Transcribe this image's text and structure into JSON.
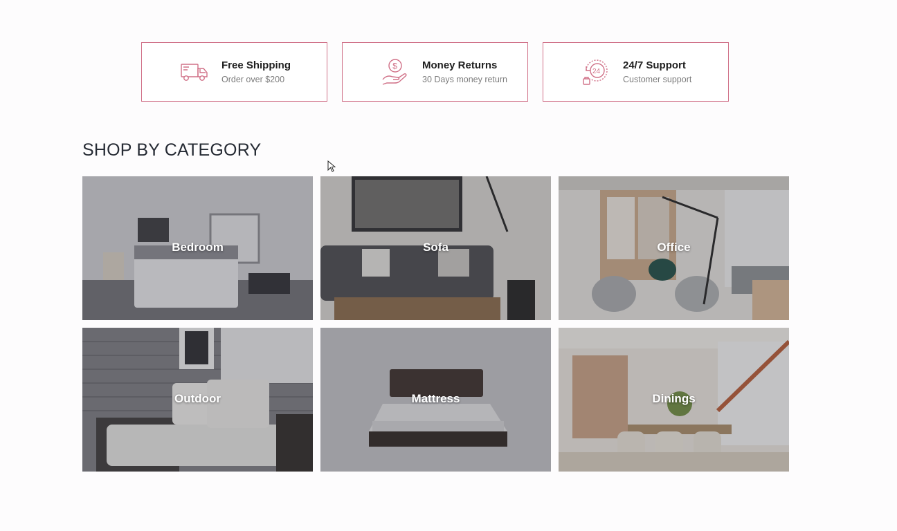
{
  "features": [
    {
      "icon": "truck-icon",
      "title": "Free Shipping",
      "subtitle": "Order over $200"
    },
    {
      "icon": "money-hand-icon",
      "title": "Money Returns",
      "subtitle": "30 Days money return"
    },
    {
      "icon": "support-24-icon",
      "title": "24/7 Support",
      "subtitle": "Customer support"
    }
  ],
  "section_title": "SHOP BY CATEGORY",
  "categories": [
    {
      "label": "Bedroom"
    },
    {
      "label": "Sofa"
    },
    {
      "label": "Office"
    },
    {
      "label": "Outdoor"
    },
    {
      "label": "Mattress"
    },
    {
      "label": "Dinings"
    }
  ],
  "colors": {
    "accent": "#d07087",
    "title": "#262b34"
  }
}
